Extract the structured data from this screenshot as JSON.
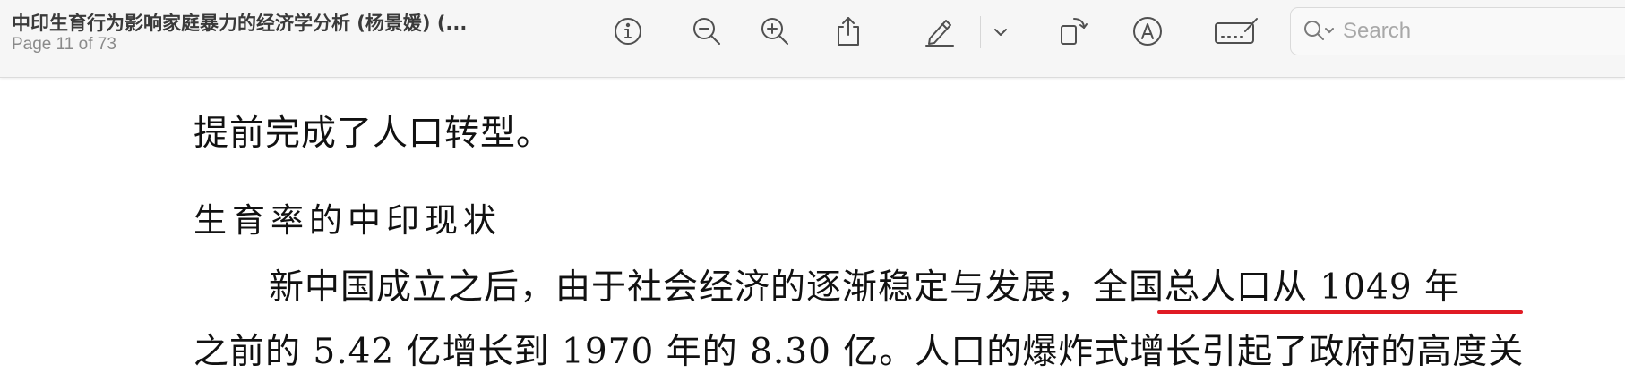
{
  "window": {
    "title": "中印生育行为影响家庭暴力的经济学分析 (杨景媛) (...",
    "page_indicator": "Page 11 of 73"
  },
  "toolbar": {
    "buttons": [
      {
        "name": "info-icon"
      },
      {
        "name": "zoom-out-icon"
      },
      {
        "name": "zoom-in-icon"
      },
      {
        "name": "share-icon"
      },
      {
        "name": "highlight-pen-icon"
      },
      {
        "name": "chevron-down-icon"
      },
      {
        "name": "rotate-icon"
      },
      {
        "name": "markup-icon"
      },
      {
        "name": "signature-icon"
      }
    ],
    "search": {
      "placeholder": "Search",
      "value": ""
    }
  },
  "document": {
    "line_completion": "提前完成了人口转型。",
    "section_heading": "生育率的中印现状",
    "paragraph_line_1": "新中国成立之后，由于社会经济的逐渐稳定与发展，全国总人口从 1049 年",
    "paragraph_line_2": "之前的 5.42 亿增长到 1970 年的 8.30 亿。人口的爆炸式增长引起了政府的高度关",
    "annotation": {
      "type": "underline",
      "color": "#e01b24",
      "text": "全国总人口从 1049 年"
    }
  }
}
